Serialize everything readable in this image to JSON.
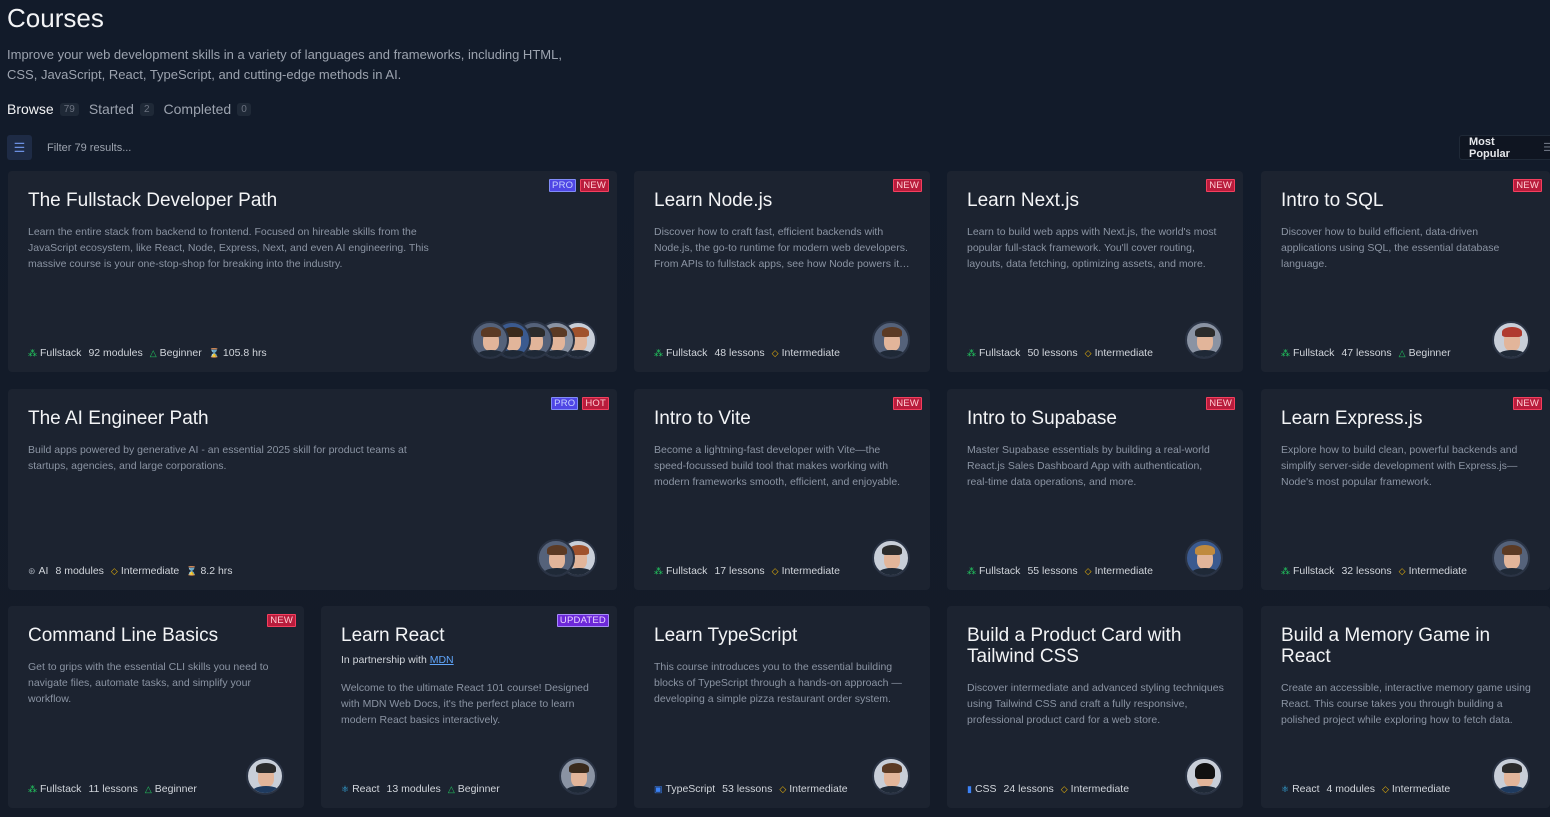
{
  "header": {
    "title": "Courses",
    "description": "Improve your web development skills in a variety of languages and frameworks, including HTML, CSS, JavaScript, React, TypeScript, and cutting-edge methods in AI."
  },
  "tabs": [
    {
      "label": "Browse",
      "count": "79"
    },
    {
      "label": "Started",
      "count": "2"
    },
    {
      "label": "Completed",
      "count": "0"
    }
  ],
  "filter": {
    "placeholder": "Filter 79 results..."
  },
  "sort": {
    "label": "Most Popular"
  },
  "courses": [
    {
      "title": "The Fullstack Developer Path",
      "badges": [
        "PRO",
        "NEW"
      ],
      "description": "Learn the entire stack from backend to frontend. Focused on hireable skills from the JavaScript ecosystem, like React, Node, Express, Next, and even AI engineering. This massive course is your one-stop-shop for breaking into the industry.",
      "category": "Fullstack",
      "units": "92 modules",
      "level": "Beginner",
      "duration": "105.8 hrs"
    },
    {
      "title": "Learn Node.js",
      "badges": [
        "NEW"
      ],
      "description": "Discover how to craft fast, efficient backends with Node.js, the go-to runtime for modern web developers. From APIs to fullstack apps, see how Node powers it all.",
      "category": "Fullstack",
      "units": "48 lessons",
      "level": "Intermediate"
    },
    {
      "title": "Learn Next.js",
      "badges": [
        "NEW"
      ],
      "description": "Learn to build web apps with Next.js, the world's most popular full-stack framework. You'll cover routing, layouts, data fetching, optimizing assets, and more.",
      "category": "Fullstack",
      "units": "50 lessons",
      "level": "Intermediate"
    },
    {
      "title": "Intro to SQL",
      "badges": [
        "NEW"
      ],
      "description": "Discover how to build efficient, data-driven applications using SQL, the essential database language.",
      "category": "Fullstack",
      "units": "47 lessons",
      "level": "Beginner"
    },
    {
      "title": "The AI Engineer Path",
      "badges": [
        "PRO",
        "HOT"
      ],
      "description": "Build apps powered by generative AI - an essential 2025 skill for product teams at startups, agencies, and large corporations.",
      "category": "AI",
      "units": "8 modules",
      "level": "Intermediate",
      "duration": "8.2 hrs"
    },
    {
      "title": "Intro to Vite",
      "badges": [
        "NEW"
      ],
      "description": "Become a lightning-fast developer with Vite—the speed-focussed build tool that makes working with modern frameworks smooth, efficient, and enjoyable.",
      "category": "Fullstack",
      "units": "17 lessons",
      "level": "Intermediate"
    },
    {
      "title": "Intro to Supabase",
      "badges": [
        "NEW"
      ],
      "description": "Master Supabase essentials by building a real-world React.js Sales Dashboard App with authentication, real-time data operations, and more.",
      "category": "Fullstack",
      "units": "55 lessons",
      "level": "Intermediate"
    },
    {
      "title": "Learn Express.js",
      "badges": [
        "NEW"
      ],
      "description": "Explore how to build clean, powerful backends and simplify server-side development with Express.js—Node's most popular framework.",
      "category": "Fullstack",
      "units": "32 lessons",
      "level": "Intermediate"
    },
    {
      "title": "Command Line Basics",
      "badges": [
        "NEW"
      ],
      "description": "Get to grips with the essential CLI skills you need to navigate files, automate tasks, and simplify your workflow.",
      "category": "Fullstack",
      "units": "11 lessons",
      "level": "Beginner"
    },
    {
      "title": "Learn React",
      "badges": [
        "UPDATED"
      ],
      "partner_prefix": "In partnership with",
      "partner_link": "MDN",
      "description": "Welcome to the ultimate React 101 course! Designed with MDN Web Docs, it's the perfect place to learn modern React basics interactively.",
      "category": "React",
      "units": "13 modules",
      "level": "Beginner"
    },
    {
      "title": "Learn TypeScript",
      "badges": [],
      "description": "This course introduces you to the essential building blocks of TypeScript through a hands-on approach —developing a simple pizza restaurant order system.",
      "category": "TypeScript",
      "units": "53 lessons",
      "level": "Intermediate"
    },
    {
      "title": "Build a Product Card with Tailwind CSS",
      "badges": [],
      "description": "Discover intermediate and advanced styling techniques using Tailwind CSS and craft a fully responsive, professional product card for a web store.",
      "category": "CSS",
      "units": "24 lessons",
      "level": "Intermediate"
    },
    {
      "title": "Build a Memory Game in React",
      "badges": [],
      "description": "Create an accessible, interactive memory game using React. This course takes you through building a polished project while exploring how to fetch data.",
      "category": "React",
      "units": "4 modules",
      "level": "Intermediate"
    }
  ]
}
